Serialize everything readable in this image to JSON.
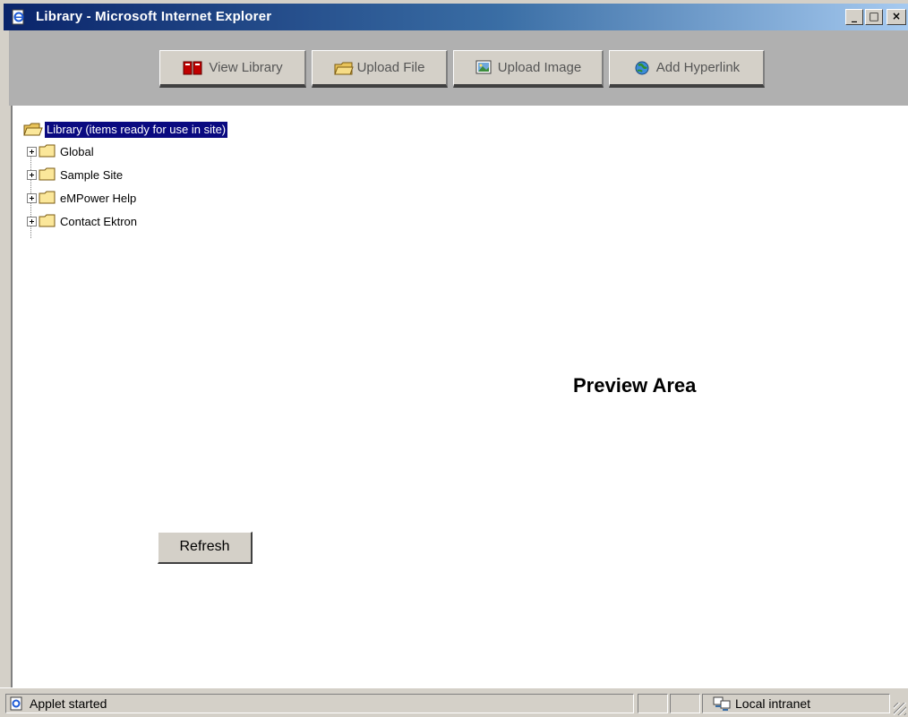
{
  "window": {
    "title": "Library - Microsoft Internet Explorer",
    "minimize_glyph": "_",
    "maximize_glyph": "□",
    "close_glyph": "×",
    "app_icon": "ie-page-icon"
  },
  "toolbar": {
    "buttons": [
      {
        "label": "View Library",
        "icon": "view-library-icon"
      },
      {
        "label": "Upload File",
        "icon": "upload-file-icon"
      },
      {
        "label": "Upload Image",
        "icon": "upload-image-icon"
      },
      {
        "label": "Add Hyperlink",
        "icon": "add-hyperlink-icon"
      }
    ]
  },
  "tree": {
    "root": {
      "label": "Library (items ready for use in site)",
      "icon": "folder-open-icon"
    },
    "items": [
      {
        "label": "Global",
        "icon": "folder-icon"
      },
      {
        "label": "Sample Site",
        "icon": "folder-icon"
      },
      {
        "label": "eMPower Help",
        "icon": "folder-icon"
      },
      {
        "label": "Contact Ektron",
        "icon": "folder-icon"
      }
    ]
  },
  "preview": {
    "label": "Preview Area"
  },
  "refresh": {
    "label": "Refresh"
  },
  "status": {
    "message": "Applet started",
    "zone": "Local intranet"
  },
  "colors": {
    "titlebar": "#0a246a",
    "selection": "#0a0a80",
    "toolbar": "#b0b0b0",
    "chrome": "#d4d0c8"
  }
}
